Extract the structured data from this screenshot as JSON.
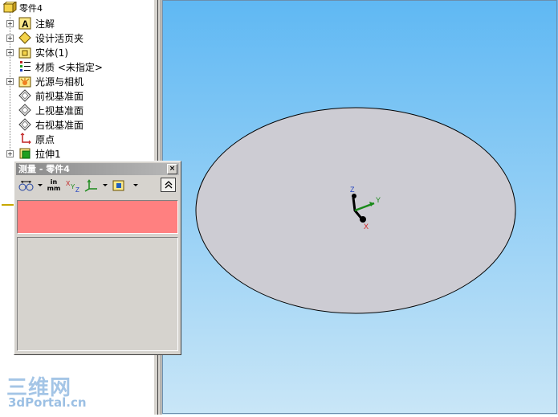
{
  "tree": {
    "root": "零件4",
    "items": [
      {
        "label": "注解",
        "icon": "annotation-icon",
        "expandable": true
      },
      {
        "label": "设计活页夹",
        "icon": "design-binder-icon",
        "expandable": true
      },
      {
        "label": "实体(1)",
        "icon": "solid-bodies-icon",
        "expandable": true
      },
      {
        "label": "材质 <未指定>",
        "icon": "material-icon",
        "expandable": false
      },
      {
        "label": "光源与相机",
        "icon": "lights-cameras-icon",
        "expandable": true
      },
      {
        "label": "前视基准面",
        "icon": "plane-icon",
        "expandable": false
      },
      {
        "label": "上视基准面",
        "icon": "plane-icon",
        "expandable": false
      },
      {
        "label": "右视基准面",
        "icon": "plane-icon",
        "expandable": false
      },
      {
        "label": "原点",
        "icon": "origin-icon",
        "expandable": false
      },
      {
        "label": "拉伸1",
        "icon": "extrude-icon",
        "expandable": true
      }
    ]
  },
  "measure": {
    "title": "测量 - 零件4",
    "close_label": "×",
    "units_label_top": "in",
    "units_label_bottom": "mm",
    "collapse_label": "⌃"
  },
  "triad": {
    "x": "X",
    "y": "Y",
    "z": "Z"
  },
  "watermark": {
    "top": "三维网",
    "bottom": "3dPortal.cn"
  },
  "colors": {
    "result_box": "#ff8080",
    "viewport_top": "#5fb8f3",
    "viewport_bottom": "#c9e6f7",
    "face": "#cdccd3"
  }
}
